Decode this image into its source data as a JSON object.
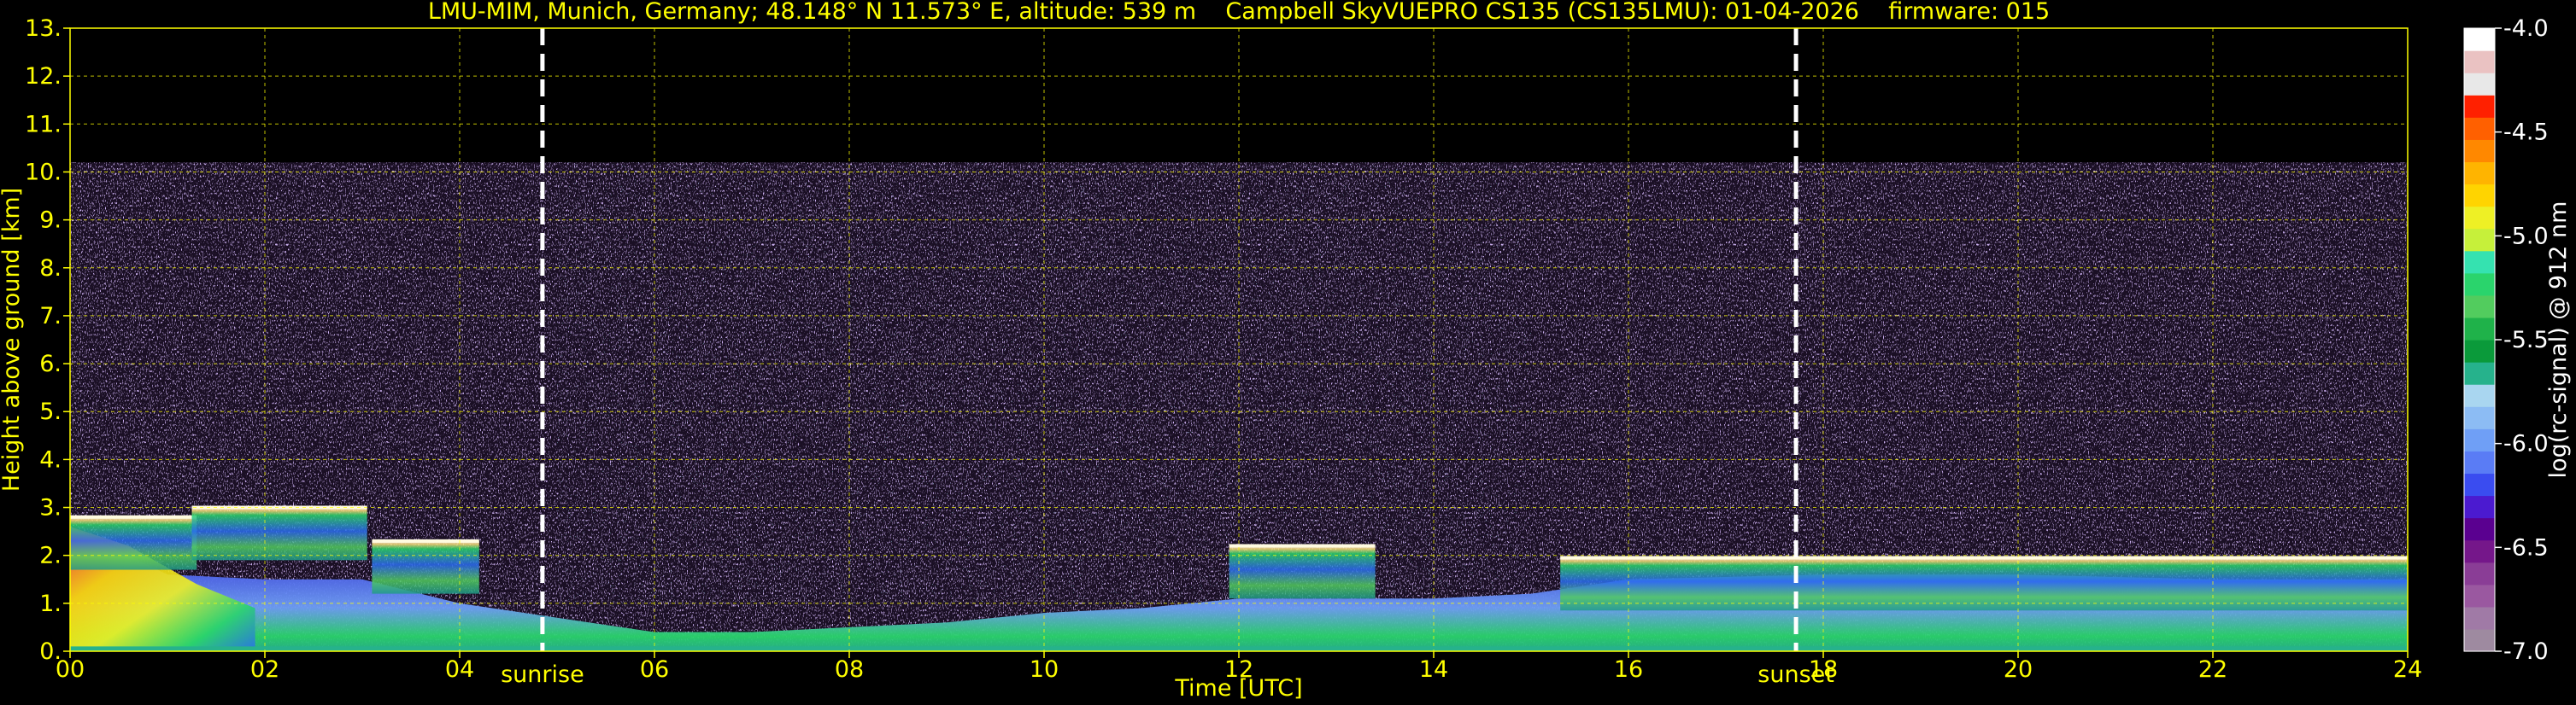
{
  "chart_data": {
    "type": "heatmap",
    "title": "LMU-MIM, Munich, Germany; 48.148° N 11.573° E, altitude: 539 m    Campbell SkyVUEPRO CS135 (CS135LMU): 01-04-2026    firmware: 015",
    "xlabel": "Time [UTC]",
    "ylabel": "Height above ground [km]",
    "xlim": [
      0,
      24
    ],
    "ylim": [
      0,
      13
    ],
    "x_ticks": [
      "00",
      "02",
      "04",
      "06",
      "08",
      "10",
      "12",
      "14",
      "16",
      "18",
      "20",
      "22",
      "24"
    ],
    "y_ticks": [
      "0.",
      "1.",
      "2.",
      "3.",
      "4.",
      "5.",
      "6.",
      "7.",
      "8.",
      "9.",
      "10.",
      "11.",
      "12.",
      "13."
    ],
    "grid": true,
    "events": [
      {
        "label": "sunrise",
        "x": 4.85
      },
      {
        "label": "sunset",
        "x": 17.72
      }
    ],
    "colorbar": {
      "label": "log(rc-signal) @ 912 nm",
      "range": [
        -7.0,
        -4.0
      ],
      "ticks": [
        "-4.0",
        "-4.5",
        "-5.0",
        "-5.5",
        "-6.0",
        "-6.5",
        "-7.0"
      ],
      "colors": [
        "#9e8aa0",
        "#a07aa6",
        "#9a58a0",
        "#8a3d96",
        "#75178a",
        "#5a0090",
        "#4b1ad0",
        "#3a4cf0",
        "#5a7cf5",
        "#6f9ff6",
        "#8cbcf4",
        "#a9d6f0",
        "#26b28c",
        "#0a9a3a",
        "#1fb24a",
        "#52cc5e",
        "#2ad46c",
        "#35e2b0",
        "#c6f03a",
        "#eef025",
        "#ffd400",
        "#ffb400",
        "#ff8800",
        "#ff6000",
        "#ff2000",
        "#e8e8e8",
        "#eac2c2",
        "#ffffff"
      ]
    },
    "features": {
      "noise_top_km": 10.2,
      "cloud_layers": [
        {
          "start": 0.0,
          "end": 1.3,
          "top_km": 2.8
        },
        {
          "start": 1.25,
          "end": 3.05,
          "top_km": 3.0
        },
        {
          "start": 3.1,
          "end": 4.2,
          "top_km": 2.3
        },
        {
          "start": 11.9,
          "end": 13.4,
          "top_km": 2.2
        },
        {
          "start": 15.3,
          "end": 24.0,
          "top_km": 1.95
        }
      ],
      "boundary_layer_km": [
        [
          0,
          2.6
        ],
        [
          1,
          1.6
        ],
        [
          2,
          1.5
        ],
        [
          3,
          1.5
        ],
        [
          4,
          1.0
        ],
        [
          5,
          0.7
        ],
        [
          6,
          0.4
        ],
        [
          7,
          0.4
        ],
        [
          8,
          0.5
        ],
        [
          9,
          0.6
        ],
        [
          10,
          0.8
        ],
        [
          11,
          0.9
        ],
        [
          12,
          1.1
        ],
        [
          13,
          1.1
        ],
        [
          14,
          1.1
        ],
        [
          15,
          1.2
        ],
        [
          16,
          1.5
        ],
        [
          17,
          1.55
        ],
        [
          18,
          1.6
        ],
        [
          19,
          1.6
        ],
        [
          20,
          1.6
        ],
        [
          21,
          1.55
        ],
        [
          22,
          1.5
        ],
        [
          23,
          1.5
        ],
        [
          24,
          1.5
        ]
      ]
    }
  }
}
